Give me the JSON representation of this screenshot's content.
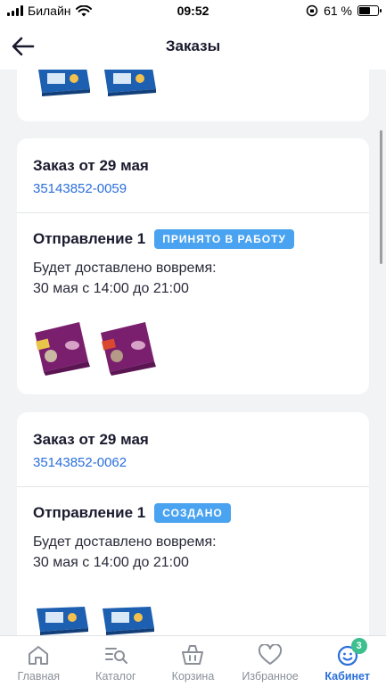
{
  "status_bar": {
    "carrier": "Билайн",
    "time": "09:52",
    "battery_percent": "61 %",
    "battery_level": 0.61
  },
  "header": {
    "title": "Заказы",
    "back_icon": "arrow-left-icon"
  },
  "orders": [
    {
      "title": "Заказ от 29 мая",
      "number": "35143852-0059",
      "shipment": {
        "title": "Отправление 1",
        "status": "ПРИНЯТО В РАБОТУ",
        "delivery_line1": "Будет доставлено вовремя:",
        "delivery_line2": "30 мая с 14:00 до 21:00"
      }
    },
    {
      "title": "Заказ от 29 мая",
      "number": "35143852-0062",
      "shipment": {
        "title": "Отправление 1",
        "status": "СОЗДАНО",
        "delivery_line1": "Будет доставлено вовремя:",
        "delivery_line2": "30 мая с 14:00 до 21:00"
      }
    }
  ],
  "nav": {
    "items": [
      {
        "label": "Главная",
        "icon": "home-icon"
      },
      {
        "label": "Каталог",
        "icon": "catalog-icon"
      },
      {
        "label": "Корзина",
        "icon": "basket-icon"
      },
      {
        "label": "Избранное",
        "icon": "heart-icon"
      },
      {
        "label": "Кабинет",
        "icon": "profile-smile-icon",
        "badge": "3",
        "active": true
      }
    ]
  },
  "colors": {
    "accent": "#2a6fdb",
    "badge_blue": "#4aa3f0",
    "nav_badge": "#3dbf8f",
    "background": "#f1f3f5"
  }
}
